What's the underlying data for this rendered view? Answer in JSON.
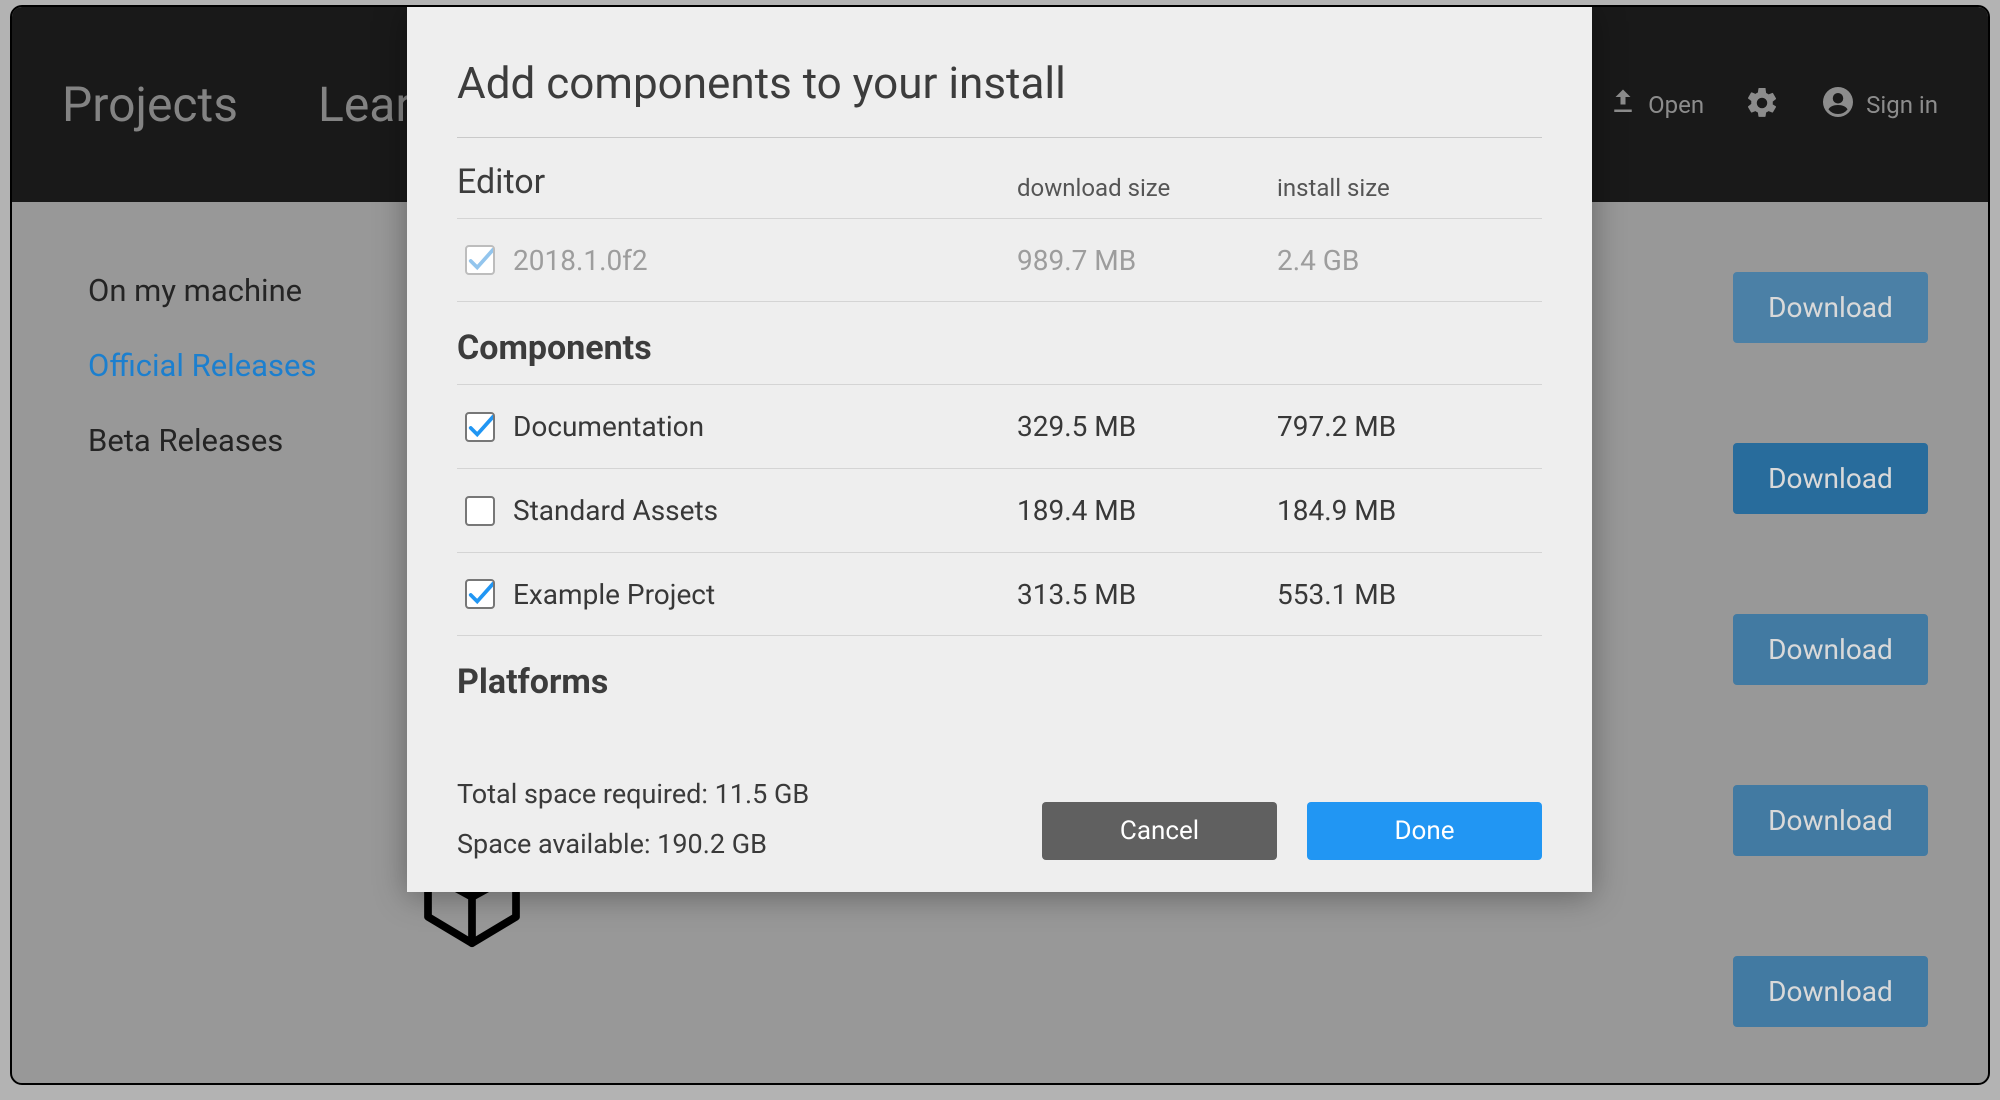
{
  "header": {
    "tabs": [
      "Projects",
      "Learn"
    ],
    "open_label": "Open",
    "signin_label": "Sign in"
  },
  "sidebar": {
    "items": [
      {
        "label": "On my machine",
        "active": false
      },
      {
        "label": "Official Releases",
        "active": true
      },
      {
        "label": "Beta Releases",
        "active": false
      }
    ]
  },
  "download_buttons": [
    "Download",
    "Download",
    "Download",
    "Download",
    "Download"
  ],
  "modal": {
    "title": "Add components to your install",
    "sections": {
      "editor": {
        "title": "Editor",
        "col_download": "download size",
        "col_install": "install size",
        "rows": [
          {
            "label": "2018.1.0f2",
            "download": "989.7 MB",
            "install": "2.4 GB",
            "checked": true,
            "disabled": true
          }
        ]
      },
      "components": {
        "title": "Components",
        "rows": [
          {
            "label": "Documentation",
            "download": "329.5 MB",
            "install": "797.2 MB",
            "checked": true
          },
          {
            "label": "Standard Assets",
            "download": "189.4 MB",
            "install": "184.9 MB",
            "checked": false
          },
          {
            "label": "Example Project",
            "download": "313.5 MB",
            "install": "553.1 MB",
            "checked": true
          }
        ]
      },
      "platforms_title": "Platforms"
    },
    "footer": {
      "required_label": "Total space required: 11.5 GB",
      "available_label": "Space available: 190.2 GB",
      "cancel": "Cancel",
      "done": "Done"
    }
  }
}
